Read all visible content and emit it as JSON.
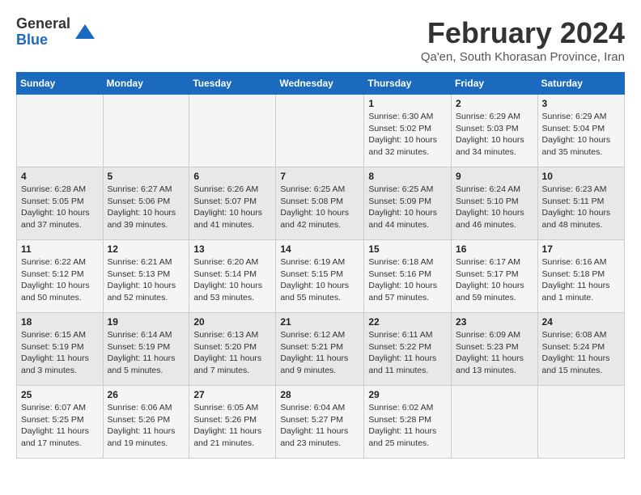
{
  "header": {
    "logo": {
      "line1": "General",
      "line2": "Blue"
    },
    "month_year": "February 2024",
    "location": "Qa'en, South Khorasan Province, Iran"
  },
  "weekdays": [
    "Sunday",
    "Monday",
    "Tuesday",
    "Wednesday",
    "Thursday",
    "Friday",
    "Saturday"
  ],
  "weeks": [
    [
      {
        "day": "",
        "info": ""
      },
      {
        "day": "",
        "info": ""
      },
      {
        "day": "",
        "info": ""
      },
      {
        "day": "",
        "info": ""
      },
      {
        "day": "1",
        "info": "Sunrise: 6:30 AM\nSunset: 5:02 PM\nDaylight: 10 hours\nand 32 minutes."
      },
      {
        "day": "2",
        "info": "Sunrise: 6:29 AM\nSunset: 5:03 PM\nDaylight: 10 hours\nand 34 minutes."
      },
      {
        "day": "3",
        "info": "Sunrise: 6:29 AM\nSunset: 5:04 PM\nDaylight: 10 hours\nand 35 minutes."
      }
    ],
    [
      {
        "day": "4",
        "info": "Sunrise: 6:28 AM\nSunset: 5:05 PM\nDaylight: 10 hours\nand 37 minutes."
      },
      {
        "day": "5",
        "info": "Sunrise: 6:27 AM\nSunset: 5:06 PM\nDaylight: 10 hours\nand 39 minutes."
      },
      {
        "day": "6",
        "info": "Sunrise: 6:26 AM\nSunset: 5:07 PM\nDaylight: 10 hours\nand 41 minutes."
      },
      {
        "day": "7",
        "info": "Sunrise: 6:25 AM\nSunset: 5:08 PM\nDaylight: 10 hours\nand 42 minutes."
      },
      {
        "day": "8",
        "info": "Sunrise: 6:25 AM\nSunset: 5:09 PM\nDaylight: 10 hours\nand 44 minutes."
      },
      {
        "day": "9",
        "info": "Sunrise: 6:24 AM\nSunset: 5:10 PM\nDaylight: 10 hours\nand 46 minutes."
      },
      {
        "day": "10",
        "info": "Sunrise: 6:23 AM\nSunset: 5:11 PM\nDaylight: 10 hours\nand 48 minutes."
      }
    ],
    [
      {
        "day": "11",
        "info": "Sunrise: 6:22 AM\nSunset: 5:12 PM\nDaylight: 10 hours\nand 50 minutes."
      },
      {
        "day": "12",
        "info": "Sunrise: 6:21 AM\nSunset: 5:13 PM\nDaylight: 10 hours\nand 52 minutes."
      },
      {
        "day": "13",
        "info": "Sunrise: 6:20 AM\nSunset: 5:14 PM\nDaylight: 10 hours\nand 53 minutes."
      },
      {
        "day": "14",
        "info": "Sunrise: 6:19 AM\nSunset: 5:15 PM\nDaylight: 10 hours\nand 55 minutes."
      },
      {
        "day": "15",
        "info": "Sunrise: 6:18 AM\nSunset: 5:16 PM\nDaylight: 10 hours\nand 57 minutes."
      },
      {
        "day": "16",
        "info": "Sunrise: 6:17 AM\nSunset: 5:17 PM\nDaylight: 10 hours\nand 59 minutes."
      },
      {
        "day": "17",
        "info": "Sunrise: 6:16 AM\nSunset: 5:18 PM\nDaylight: 11 hours\nand 1 minute."
      }
    ],
    [
      {
        "day": "18",
        "info": "Sunrise: 6:15 AM\nSunset: 5:19 PM\nDaylight: 11 hours\nand 3 minutes."
      },
      {
        "day": "19",
        "info": "Sunrise: 6:14 AM\nSunset: 5:19 PM\nDaylight: 11 hours\nand 5 minutes."
      },
      {
        "day": "20",
        "info": "Sunrise: 6:13 AM\nSunset: 5:20 PM\nDaylight: 11 hours\nand 7 minutes."
      },
      {
        "day": "21",
        "info": "Sunrise: 6:12 AM\nSunset: 5:21 PM\nDaylight: 11 hours\nand 9 minutes."
      },
      {
        "day": "22",
        "info": "Sunrise: 6:11 AM\nSunset: 5:22 PM\nDaylight: 11 hours\nand 11 minutes."
      },
      {
        "day": "23",
        "info": "Sunrise: 6:09 AM\nSunset: 5:23 PM\nDaylight: 11 hours\nand 13 minutes."
      },
      {
        "day": "24",
        "info": "Sunrise: 6:08 AM\nSunset: 5:24 PM\nDaylight: 11 hours\nand 15 minutes."
      }
    ],
    [
      {
        "day": "25",
        "info": "Sunrise: 6:07 AM\nSunset: 5:25 PM\nDaylight: 11 hours\nand 17 minutes."
      },
      {
        "day": "26",
        "info": "Sunrise: 6:06 AM\nSunset: 5:26 PM\nDaylight: 11 hours\nand 19 minutes."
      },
      {
        "day": "27",
        "info": "Sunrise: 6:05 AM\nSunset: 5:26 PM\nDaylight: 11 hours\nand 21 minutes."
      },
      {
        "day": "28",
        "info": "Sunrise: 6:04 AM\nSunset: 5:27 PM\nDaylight: 11 hours\nand 23 minutes."
      },
      {
        "day": "29",
        "info": "Sunrise: 6:02 AM\nSunset: 5:28 PM\nDaylight: 11 hours\nand 25 minutes."
      },
      {
        "day": "",
        "info": ""
      },
      {
        "day": "",
        "info": ""
      }
    ]
  ]
}
